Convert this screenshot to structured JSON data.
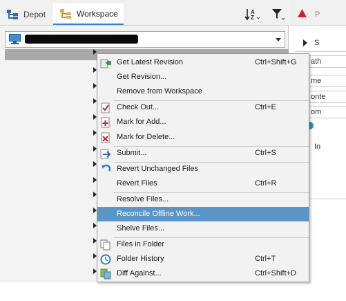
{
  "tabs": {
    "depot": "Depot",
    "workspace": "Workspace"
  },
  "right_panel": {
    "labels": [
      "P",
      "S",
      "ath",
      "me",
      "onte",
      "om",
      "In"
    ]
  },
  "context_menu": {
    "items": [
      {
        "label": "Get Latest Revision",
        "shortcut": "Ctrl+Shift+G",
        "icon": "download-green-icon"
      },
      {
        "label": "Get Revision...",
        "shortcut": "",
        "icon": ""
      },
      {
        "label": "Remove from Workspace",
        "shortcut": "",
        "icon": ""
      },
      {
        "label": "Check Out...",
        "shortcut": "Ctrl+E",
        "icon": "checkout-icon"
      },
      {
        "label": "Mark for Add...",
        "shortcut": "",
        "icon": "mark-add-icon"
      },
      {
        "label": "Mark for Delete...",
        "shortcut": "",
        "icon": "mark-delete-icon"
      },
      {
        "label": "Submit...",
        "shortcut": "Ctrl+S",
        "icon": "submit-icon"
      },
      {
        "label": "Revert Unchanged Files",
        "shortcut": "",
        "icon": "revert-icon"
      },
      {
        "label": "Revert Files",
        "shortcut": "Ctrl+R",
        "icon": ""
      },
      {
        "label": "Resolve Files...",
        "shortcut": "",
        "icon": ""
      },
      {
        "label": "Reconcile Offline Work...",
        "shortcut": "",
        "icon": ""
      },
      {
        "label": "Shelve Files...",
        "shortcut": "",
        "icon": ""
      },
      {
        "label": "Files in Folder",
        "shortcut": "",
        "icon": "files-in-folder-icon"
      },
      {
        "label": "Folder History",
        "shortcut": "Ctrl+T",
        "icon": "history-clock-icon"
      },
      {
        "label": "Diff Against...",
        "shortcut": "Ctrl+Shift+D",
        "icon": "diff-icon"
      }
    ],
    "highlighted_index": 10
  },
  "colors": {
    "highlight": "#5b95c6",
    "tab_underline": "#3a7bd5",
    "alert": "#d21f2a"
  }
}
